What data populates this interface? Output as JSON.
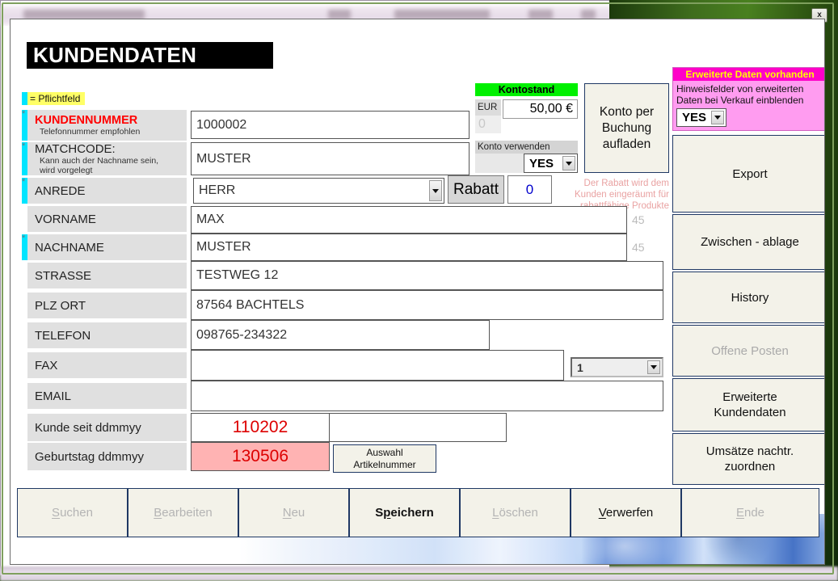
{
  "window": {
    "close_label": "x",
    "title": "KUNDENDATEN"
  },
  "legend": {
    "text": "= Pflichtfeld"
  },
  "form": {
    "rows": [
      {
        "label": "KUNDENNUMMER",
        "sub": "Telefonnummer empfohlen",
        "value": "1000002",
        "required": true,
        "red": true
      },
      {
        "label": "MATCHCODE:",
        "sub": "Kann auch der Nachname sein,\nwird vorgelegt",
        "value": "MUSTER",
        "required": true,
        "red": false
      },
      {
        "label": "ANREDE",
        "sub": "",
        "value": "HERR",
        "required": true,
        "red": false
      },
      {
        "label": "VORNAME",
        "sub": "",
        "value": "MAX",
        "required": false,
        "red": false,
        "counter": "45"
      },
      {
        "label": "NACHNAME",
        "sub": "",
        "value": "MUSTER",
        "required": true,
        "red": false,
        "counter": "45"
      },
      {
        "label": "STRASSE",
        "sub": "",
        "value": "TESTWEG 12",
        "required": false,
        "red": false
      },
      {
        "label": "PLZ ORT",
        "sub": "",
        "value": "87564 BACHTELS",
        "required": false,
        "red": false
      },
      {
        "label": "TELEFON",
        "sub": "",
        "value": "098765-234322",
        "required": false,
        "red": false
      },
      {
        "label": "FAX",
        "sub": "",
        "value": "",
        "required": false,
        "red": false
      },
      {
        "label": "EMAIL",
        "sub": "",
        "value": "",
        "required": false,
        "red": false
      },
      {
        "label": "Kunde seit  ddmmyy",
        "sub": "",
        "value": "110202",
        "required": false,
        "red": false
      },
      {
        "label": "Geburtstag  ddmmyy",
        "sub": "",
        "value": "130506",
        "required": false,
        "red": false
      }
    ],
    "fax_select": {
      "value": "1"
    },
    "auswahl_button": "Auswahl\nArtikelnummer"
  },
  "konto": {
    "header": "Kontostand",
    "currency_label": "EUR",
    "currency_zero": "0",
    "balance": "50,00 €",
    "use_account_label": "Konto verwenden",
    "use_account_value": "YES",
    "recharge_button": "Konto per\nBuchung\naufladen"
  },
  "rabatt": {
    "button_label": "Rabatt",
    "value": "0",
    "note": "Der Rabatt wird dem Kunden eingeräumt für rabattfähige Produkte"
  },
  "extended": {
    "header": "Erweiterte Daten vorhanden",
    "note": "Hinweisfelder von erweiterten Daten bei Verkauf einblenden",
    "select_value": "YES"
  },
  "side_buttons": [
    {
      "label": "Export",
      "disabled": false
    },
    {
      "label": "Zwischen - ablage",
      "disabled": false
    },
    {
      "label": "History",
      "disabled": false
    },
    {
      "label": "Offene Posten",
      "disabled": true
    },
    {
      "label": "Erweiterte\nKundendaten",
      "disabled": false
    },
    {
      "label": "Umsätze nachtr.\nzuordnen",
      "disabled": false
    }
  ],
  "bottom_buttons": [
    {
      "label": "Suchen",
      "accel": "S",
      "disabled": true
    },
    {
      "label": "Bearbeiten",
      "accel": "B",
      "disabled": true
    },
    {
      "label": "Neu",
      "accel": "N",
      "disabled": true
    },
    {
      "label": "Speichern",
      "accel": "p",
      "disabled": false
    },
    {
      "label": "Löschen",
      "accel": "L",
      "disabled": true
    },
    {
      "label": "Verwerfen",
      "accel": "V",
      "disabled": false
    },
    {
      "label": "Ende",
      "accel": "E",
      "disabled": true
    }
  ],
  "colors": {
    "required_marker": "#00e5ff",
    "legend_bg": "#ffff66",
    "kontostand_header": "#00f000",
    "extended_header_bg": "#ff00c8",
    "extended_header_fg": "#ffff00",
    "extended_panel_bg": "#ff9cf0",
    "date_highlight": "#ffb3b3",
    "date_text": "#dd0000",
    "mandatory_label": "#ff0000"
  }
}
